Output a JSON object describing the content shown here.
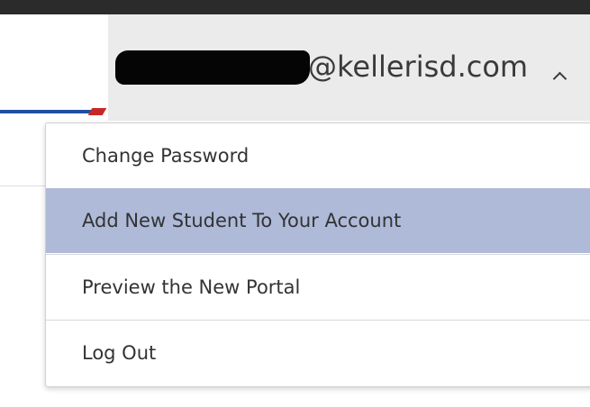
{
  "header": {
    "account_email_visible": "@kellerisd.com",
    "brand_colors": {
      "blue": "#1f4fa0",
      "red": "#c62828"
    },
    "toggle_icon": "chevron-up-icon"
  },
  "account_menu": {
    "items": [
      {
        "label": "Change Password"
      },
      {
        "label": "Add New Student To Your Account",
        "highlighted": true
      },
      {
        "label": "Preview the New Portal"
      },
      {
        "label": "Log Out"
      }
    ],
    "highlight_color": "#aebad8"
  }
}
